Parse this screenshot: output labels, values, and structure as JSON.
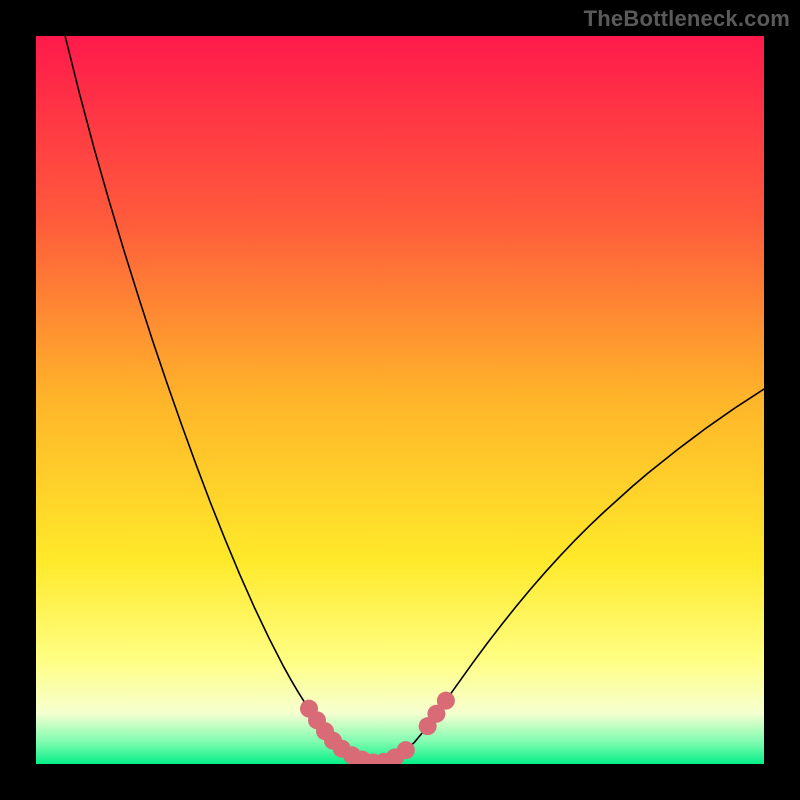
{
  "watermark": "TheBottleneck.com",
  "chart_data": {
    "type": "line",
    "title": "",
    "subtitle": "",
    "xlabel": "",
    "ylabel": "",
    "xlim": [
      0,
      100
    ],
    "ylim": [
      0,
      100
    ],
    "grid": false,
    "legend": false,
    "background": {
      "type": "vertical-gradient",
      "stops": [
        {
          "pos": 0.0,
          "color": "#ff1a4b"
        },
        {
          "pos": 0.25,
          "color": "#ff5a3c"
        },
        {
          "pos": 0.5,
          "color": "#ffb52a"
        },
        {
          "pos": 0.72,
          "color": "#ffe92a"
        },
        {
          "pos": 0.86,
          "color": "#ffff85"
        },
        {
          "pos": 0.93,
          "color": "#f6ffd0"
        },
        {
          "pos": 0.97,
          "color": "#7efcb0"
        },
        {
          "pos": 1.0,
          "color": "#05ee87"
        }
      ]
    },
    "series": [
      {
        "name": "bottleneck-curve",
        "color": "#000000",
        "points": [
          {
            "x": 4.0,
            "y": 100.0
          },
          {
            "x": 6.0,
            "y": 92.0
          },
          {
            "x": 8.0,
            "y": 84.5
          },
          {
            "x": 10.0,
            "y": 77.5
          },
          {
            "x": 12.0,
            "y": 70.8
          },
          {
            "x": 14.0,
            "y": 64.4
          },
          {
            "x": 16.0,
            "y": 58.2
          },
          {
            "x": 18.0,
            "y": 52.3
          },
          {
            "x": 20.0,
            "y": 46.6
          },
          {
            "x": 22.0,
            "y": 41.1
          },
          {
            "x": 24.0,
            "y": 35.8
          },
          {
            "x": 26.0,
            "y": 30.8
          },
          {
            "x": 28.0,
            "y": 26.0
          },
          {
            "x": 30.0,
            "y": 21.5
          },
          {
            "x": 32.0,
            "y": 17.3
          },
          {
            "x": 34.0,
            "y": 13.4
          },
          {
            "x": 35.0,
            "y": 11.6
          },
          {
            "x": 36.0,
            "y": 9.9
          },
          {
            "x": 37.0,
            "y": 8.3
          },
          {
            "x": 38.0,
            "y": 6.8
          },
          {
            "x": 39.0,
            "y": 5.4
          },
          {
            "x": 40.0,
            "y": 4.1
          },
          {
            "x": 41.0,
            "y": 3.0
          },
          {
            "x": 42.0,
            "y": 2.1
          },
          {
            "x": 43.0,
            "y": 1.4
          },
          {
            "x": 44.0,
            "y": 0.8
          },
          {
            "x": 45.0,
            "y": 0.4
          },
          {
            "x": 46.0,
            "y": 0.2
          },
          {
            "x": 47.0,
            "y": 0.2
          },
          {
            "x": 48.0,
            "y": 0.4
          },
          {
            "x": 49.0,
            "y": 0.8
          },
          {
            "x": 50.0,
            "y": 1.4
          },
          {
            "x": 51.0,
            "y": 2.1
          },
          {
            "x": 52.0,
            "y": 3.0
          },
          {
            "x": 53.0,
            "y": 4.2
          },
          {
            "x": 54.0,
            "y": 5.5
          },
          {
            "x": 55.0,
            "y": 6.9
          },
          {
            "x": 56.0,
            "y": 8.3
          },
          {
            "x": 58.0,
            "y": 11.1
          },
          {
            "x": 60.0,
            "y": 13.9
          },
          {
            "x": 62.0,
            "y": 16.6
          },
          {
            "x": 64.0,
            "y": 19.2
          },
          {
            "x": 66.0,
            "y": 21.7
          },
          {
            "x": 68.0,
            "y": 24.1
          },
          {
            "x": 70.0,
            "y": 26.4
          },
          {
            "x": 72.0,
            "y": 28.6
          },
          {
            "x": 74.0,
            "y": 30.7
          },
          {
            "x": 76.0,
            "y": 32.7
          },
          {
            "x": 78.0,
            "y": 34.6
          },
          {
            "x": 80.0,
            "y": 36.4
          },
          {
            "x": 82.0,
            "y": 38.2
          },
          {
            "x": 84.0,
            "y": 39.9
          },
          {
            "x": 86.0,
            "y": 41.5
          },
          {
            "x": 88.0,
            "y": 43.1
          },
          {
            "x": 90.0,
            "y": 44.6
          },
          {
            "x": 92.0,
            "y": 46.1
          },
          {
            "x": 94.0,
            "y": 47.5
          },
          {
            "x": 96.0,
            "y": 48.9
          },
          {
            "x": 98.0,
            "y": 50.2
          },
          {
            "x": 100.0,
            "y": 51.5
          }
        ]
      }
    ],
    "markers": {
      "name": "highlight-cluster",
      "color": "#d96b77",
      "radius_px": 9,
      "points": [
        {
          "x": 37.5,
          "y": 7.6
        },
        {
          "x": 38.6,
          "y": 6.0
        },
        {
          "x": 39.7,
          "y": 4.5
        },
        {
          "x": 40.8,
          "y": 3.2
        },
        {
          "x": 42.0,
          "y": 2.1
        },
        {
          "x": 43.4,
          "y": 1.2
        },
        {
          "x": 44.8,
          "y": 0.6
        },
        {
          "x": 46.3,
          "y": 0.2
        },
        {
          "x": 47.8,
          "y": 0.3
        },
        {
          "x": 49.3,
          "y": 0.9
        },
        {
          "x": 50.8,
          "y": 1.9
        },
        {
          "x": 53.8,
          "y": 5.2
        },
        {
          "x": 55.0,
          "y": 6.9
        },
        {
          "x": 56.3,
          "y": 8.7
        }
      ]
    },
    "annotations": []
  }
}
